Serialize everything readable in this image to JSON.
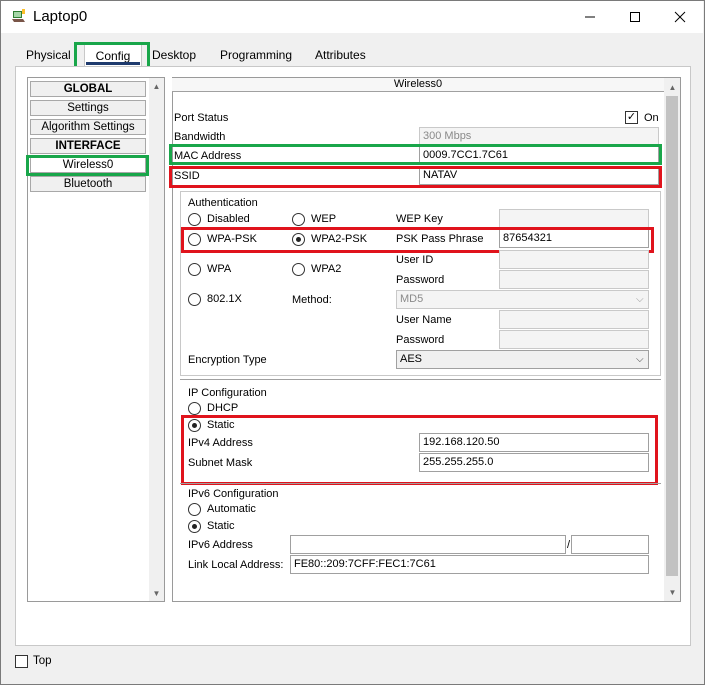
{
  "window": {
    "title": "Laptop0"
  },
  "tabs": [
    {
      "label": "Physical"
    },
    {
      "label": "Config"
    },
    {
      "label": "Desktop"
    },
    {
      "label": "Programming"
    },
    {
      "label": "Attributes"
    }
  ],
  "sidebar": {
    "global_header": "GLOBAL",
    "settings": "Settings",
    "algorithm_settings": "Algorithm Settings",
    "interface_header": "INTERFACE",
    "wireless0": "Wireless0",
    "bluetooth": "Bluetooth"
  },
  "panel": {
    "title": "Wireless0",
    "port_status_label": "Port Status",
    "port_on_label": "On",
    "port_on_checked": true,
    "bandwidth_label": "Bandwidth",
    "bandwidth_value": "300 Mbps",
    "mac_label": "MAC Address",
    "mac_value": "0009.7CC1.7C61",
    "ssid_label": "SSID",
    "ssid_value": "NATAV"
  },
  "auth": {
    "title": "Authentication",
    "disabled": "Disabled",
    "wep": "WEP",
    "wep_key_label": "WEP Key",
    "wep_key_value": "",
    "wpa_psk": "WPA-PSK",
    "wpa2_psk": "WPA2-PSK",
    "psk_label": "PSK Pass Phrase",
    "psk_value": "87654321",
    "user_id_label": "User ID",
    "password_label": "Password",
    "wpa": "WPA",
    "wpa2": "WPA2",
    "dot1x": "802.1X",
    "method_label": "Method:",
    "method_value": "MD5",
    "user_name_label": "User Name",
    "password2_label": "Password",
    "encryption_label": "Encryption Type",
    "encryption_value": "AES",
    "selected": "wpa2_psk"
  },
  "ipconfig": {
    "title": "IP Configuration",
    "dhcp": "DHCP",
    "static": "Static",
    "selected": "static",
    "ipv4_label": "IPv4 Address",
    "ipv4_value": "192.168.120.50",
    "mask_label": "Subnet Mask",
    "mask_value": "255.255.255.0"
  },
  "ipv6": {
    "title": "IPv6 Configuration",
    "automatic": "Automatic",
    "static": "Static",
    "selected": "static",
    "addr_label": "IPv6 Address",
    "addr_value": "",
    "prefix_sep": "/",
    "prefix_value": "",
    "link_local_label": "Link Local Address:",
    "link_local_value": "FE80::209:7CFF:FEC1:7C61"
  },
  "footer": {
    "top_label": "Top",
    "top_checked": false
  },
  "colors": {
    "highlight_green": "#19a64a",
    "highlight_red": "#e0131c",
    "tab_underline": "#1f3b6e"
  }
}
